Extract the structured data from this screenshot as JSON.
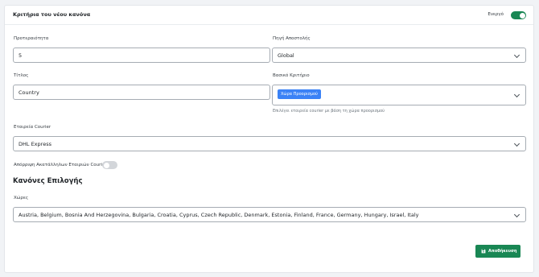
{
  "header": {
    "title": "Κριτήρια του νέου κανόνα",
    "active_label": "Ενεργό",
    "active": true
  },
  "priority": {
    "label": "Προτεραιότητα",
    "value": "5"
  },
  "sender_source": {
    "label": "Πηγή Αποστολής",
    "value": "Global"
  },
  "title_field": {
    "label": "Τίτλος",
    "value": "Country"
  },
  "main_criterion": {
    "label": "Βασικό Κριτήριο",
    "chip": "Χώρα Προορισμού",
    "help": "Επιλέγει εταιρεία courier με βάση τη χώρα προορισμού"
  },
  "courier": {
    "label": "Εταιρεία Courier",
    "value": "DHL Express"
  },
  "reject_toggle": {
    "label": "Απόρριψη Ακατάλληλων Εταιριών Courier",
    "on": false
  },
  "selection_rules": {
    "title": "Κανόνες Επιλογής",
    "countries_label": "Χώρες",
    "countries_value": "Austria, Belgium, Bosnia And Herzegovina, Bulgaria, Croatia, Cyprus, Czech Republic, Denmark, Estonia, Finland, France, Germany, Hungary, Israel, Italy"
  },
  "save_button": {
    "label": "Αποθήκευση",
    "icon": "save-icon"
  },
  "colors": {
    "accent": "#198754",
    "chip": "#3b82f6"
  }
}
